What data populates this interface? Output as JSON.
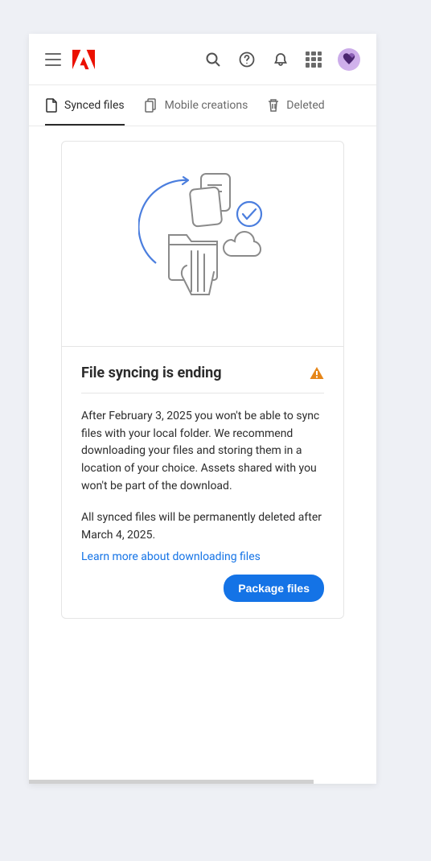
{
  "tabs": [
    {
      "label": "Synced files",
      "active": true
    },
    {
      "label": "Mobile creations",
      "active": false
    },
    {
      "label": "Deleted",
      "active": false
    }
  ],
  "notice": {
    "title": "File syncing is ending",
    "paragraph1": "After February 3, 2025 you won't be able to sync files with your local folder. We recommend downloading your files and storing them in a location of your choice. Assets shared with you won't be part of the download.",
    "paragraph2": "All synced files will be permanently deleted after March 4, 2025.",
    "link_label": "Learn more about downloading files",
    "primary_button": "Package files"
  }
}
